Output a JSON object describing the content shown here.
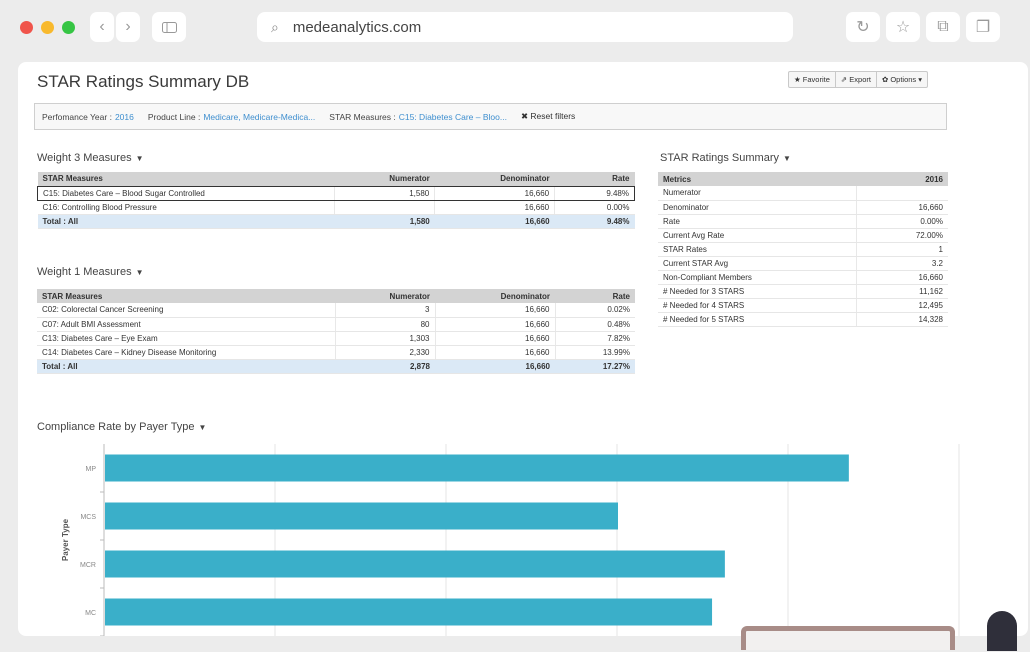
{
  "browser": {
    "url": "medeanalytics.com",
    "colors": {
      "red": "#f0544b",
      "yellow": "#f8b92d",
      "green": "#36c544"
    }
  },
  "page": {
    "title": "STAR Ratings Summary DB",
    "actions": {
      "favorite": "★ Favorite",
      "export": "⇗ Export",
      "options": "✿ Options ▾"
    },
    "filters": {
      "year_label": "Perfomance Year :",
      "year_value": "2016",
      "product_label": "Product Line :",
      "product_value": "Medicare, Medicare-Medica...",
      "measures_label": "STAR Measures :",
      "measures_value": "C15: Diabetes Care – Bloo...",
      "reset": "✖ Reset filters"
    }
  },
  "weight3": {
    "title": "Weight 3 Measures",
    "headers": [
      "STAR Measures",
      "Numerator",
      "Denominator",
      "Rate"
    ],
    "rows": [
      [
        "C15: Diabetes Care – Blood Sugar Controlled",
        "1,580",
        "16,660",
        "9.48%"
      ],
      [
        "C16: Controlling Blood Pressure",
        "",
        "16,660",
        "0.00%"
      ]
    ],
    "total": [
      "Total : All",
      "1,580",
      "16,660",
      "9.48%"
    ]
  },
  "weight1": {
    "title": "Weight 1 Measures",
    "headers": [
      "STAR Measures",
      "Numerator",
      "Denominator",
      "Rate"
    ],
    "rows": [
      [
        "C02: Colorectal Cancer Screening",
        "3",
        "16,660",
        "0.02%"
      ],
      [
        "C07: Adult BMI Assessment",
        "80",
        "16,660",
        "0.48%"
      ],
      [
        "C13: Diabetes Care – Eye Exam",
        "1,303",
        "16,660",
        "7.82%"
      ],
      [
        "C14: Diabetes Care – Kidney Disease Monitoring",
        "2,330",
        "16,660",
        "13.99%"
      ]
    ],
    "total": [
      "Total : All",
      "2,878",
      "16,660",
      "17.27%"
    ]
  },
  "summary": {
    "title": "STAR Ratings Summary",
    "headers": [
      "Metrics",
      "2016"
    ],
    "rows": [
      [
        "Numerator",
        ""
      ],
      [
        "Denominator",
        "16,660"
      ],
      [
        "Rate",
        "0.00%"
      ],
      [
        "Current Avg Rate",
        "72.00%"
      ],
      [
        "STAR Rates",
        "1"
      ],
      [
        "Current STAR Avg",
        "3.2"
      ],
      [
        "Non-Compliant Members",
        "16,660"
      ],
      [
        "# Needed for 3 STARS",
        "11,162"
      ],
      [
        "# Needed for 4 STARS",
        "12,495"
      ],
      [
        "# Needed for 5 STARS",
        "14,328"
      ]
    ]
  },
  "compliance": {
    "title": "Compliance Rate by Payer Type"
  },
  "chart_data": {
    "type": "bar",
    "orientation": "horizontal",
    "categories": [
      "MP",
      "MCS",
      "MCR",
      "MC"
    ],
    "values": [
      0.87,
      0.6,
      0.725,
      0.71
    ],
    "ylabel": "Payer Type",
    "xlim": [
      0,
      1
    ],
    "grid": true,
    "color": "#3aafc9"
  }
}
